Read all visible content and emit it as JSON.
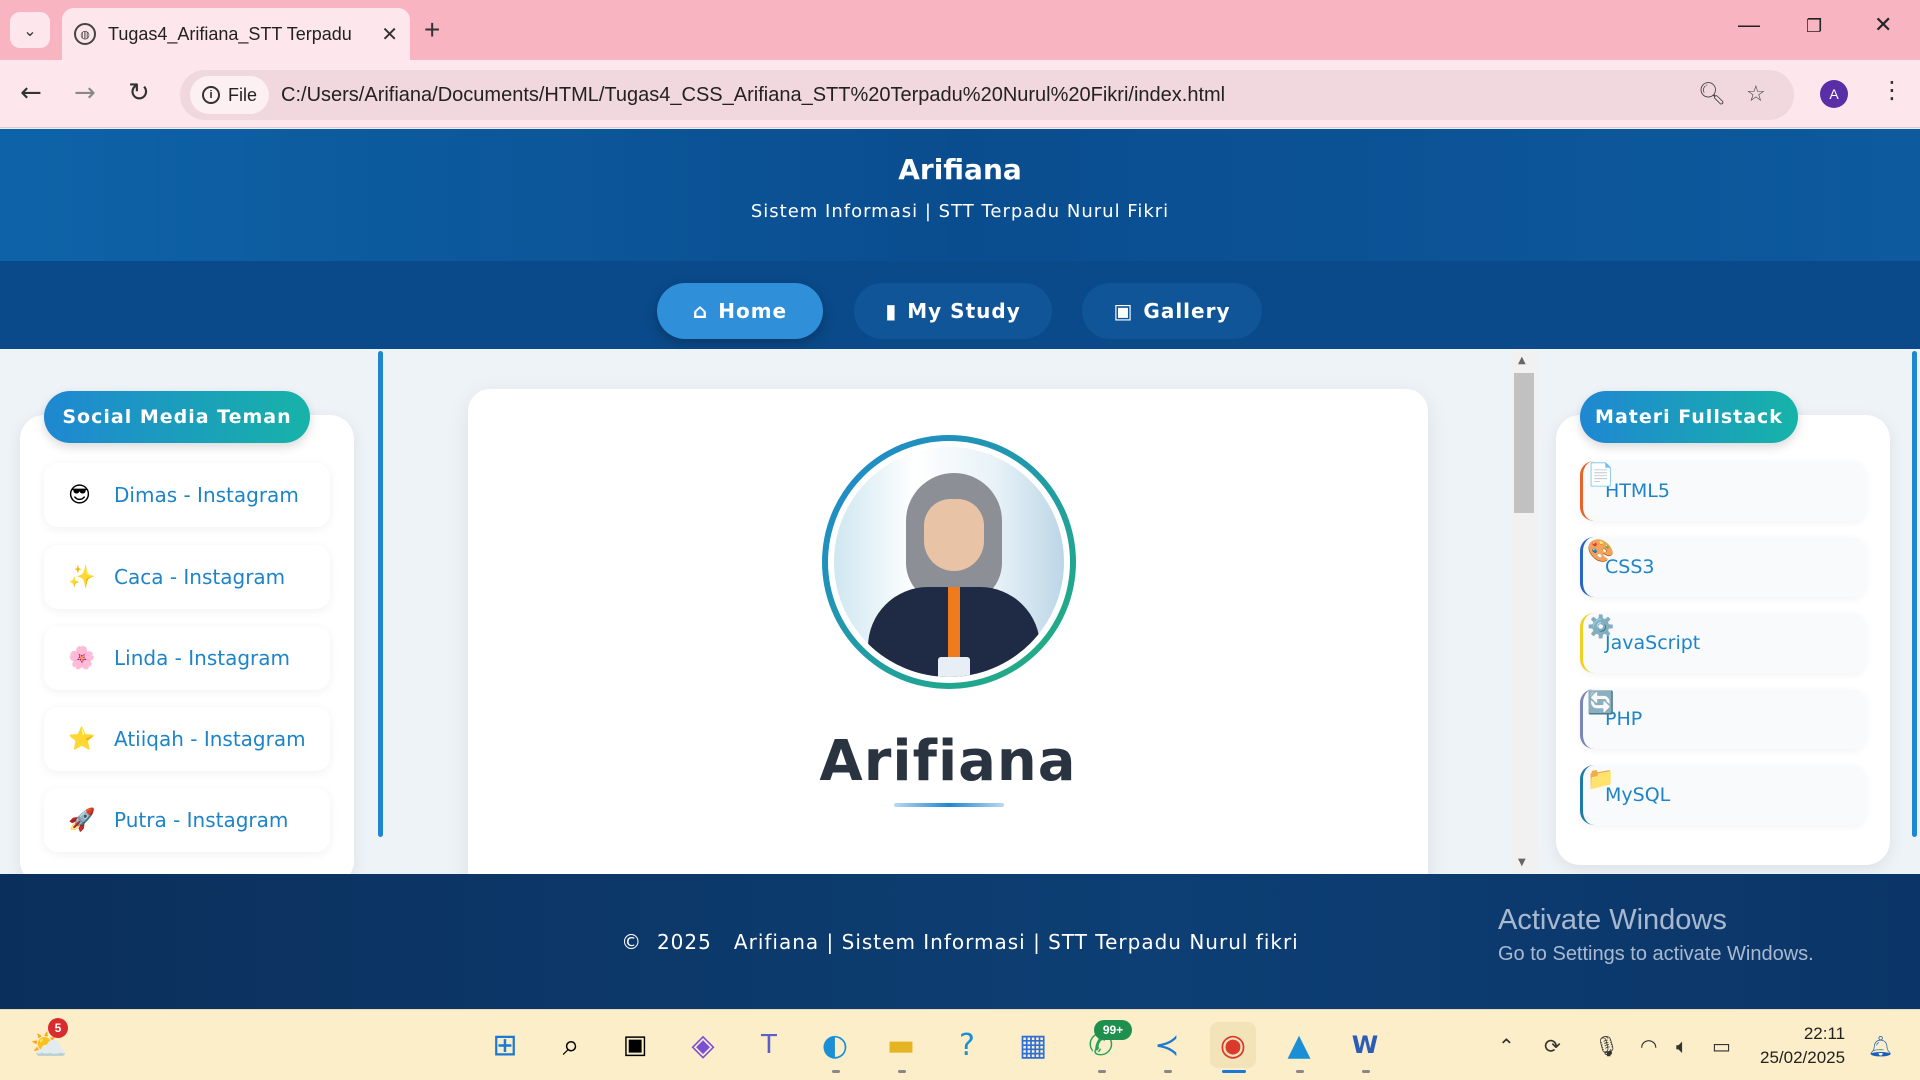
{
  "browser": {
    "tab_title": "Tugas4_Arifiana_STT Terpadu N",
    "file_chip": "File",
    "url": "C:/Users/Arifiana/Documents/HTML/Tugas4_CSS_Arifiana_STT%20Terpadu%20Nurul%20Fikri/index.html",
    "profile_initial": "A"
  },
  "header": {
    "name": "Arifiana",
    "subtitle": "Sistem Informasi | STT Terpadu Nurul Fikri"
  },
  "nav": [
    {
      "label": "Home",
      "icon": "home-icon",
      "active": true
    },
    {
      "label": "My Study",
      "icon": "book-icon",
      "active": false
    },
    {
      "label": "Gallery",
      "icon": "gallery-icon",
      "active": false
    }
  ],
  "left_panel": {
    "title": "Social Media Teman",
    "items": [
      {
        "emoji": "😎",
        "label": "Dimas - Instagram"
      },
      {
        "emoji": "✨",
        "label": "Caca - Instagram"
      },
      {
        "emoji": "🌸",
        "label": "Linda - Instagram"
      },
      {
        "emoji": "⭐",
        "label": "Atiiqah - Instagram"
      },
      {
        "emoji": "🚀",
        "label": "Putra - Instagram"
      }
    ]
  },
  "main": {
    "name": "Arifiana"
  },
  "right_panel": {
    "title": "Materi Fullstack",
    "items": [
      {
        "emoji": "📄",
        "label": "HTML5",
        "accent": "#e8632b"
      },
      {
        "emoji": "🎨",
        "label": "CSS3",
        "accent": "#2a64c8"
      },
      {
        "emoji": "⚙️",
        "label": "JavaScript",
        "accent": "#f0d020"
      },
      {
        "emoji": "🔄",
        "label": "PHP",
        "accent": "#7a86b8"
      },
      {
        "emoji": "📁",
        "label": "MySQL",
        "accent": "#1e7aa8"
      }
    ]
  },
  "footer": {
    "text": "©  2025   Arifiana | Sistem Informasi | STT Terpadu Nurul fikri"
  },
  "watermark": {
    "line1": "Activate Windows",
    "line2": "Go to Settings to activate Windows."
  },
  "taskbar": {
    "weather_badge": "5",
    "whatsapp_badge": "99+",
    "time": "22:11",
    "date": "25/02/2025"
  },
  "colors": {
    "header_blue": "#0a4d8f",
    "accent_blue": "#1f87d2",
    "accent_teal": "#17b3a8",
    "footer_navy": "#0d3f74"
  }
}
